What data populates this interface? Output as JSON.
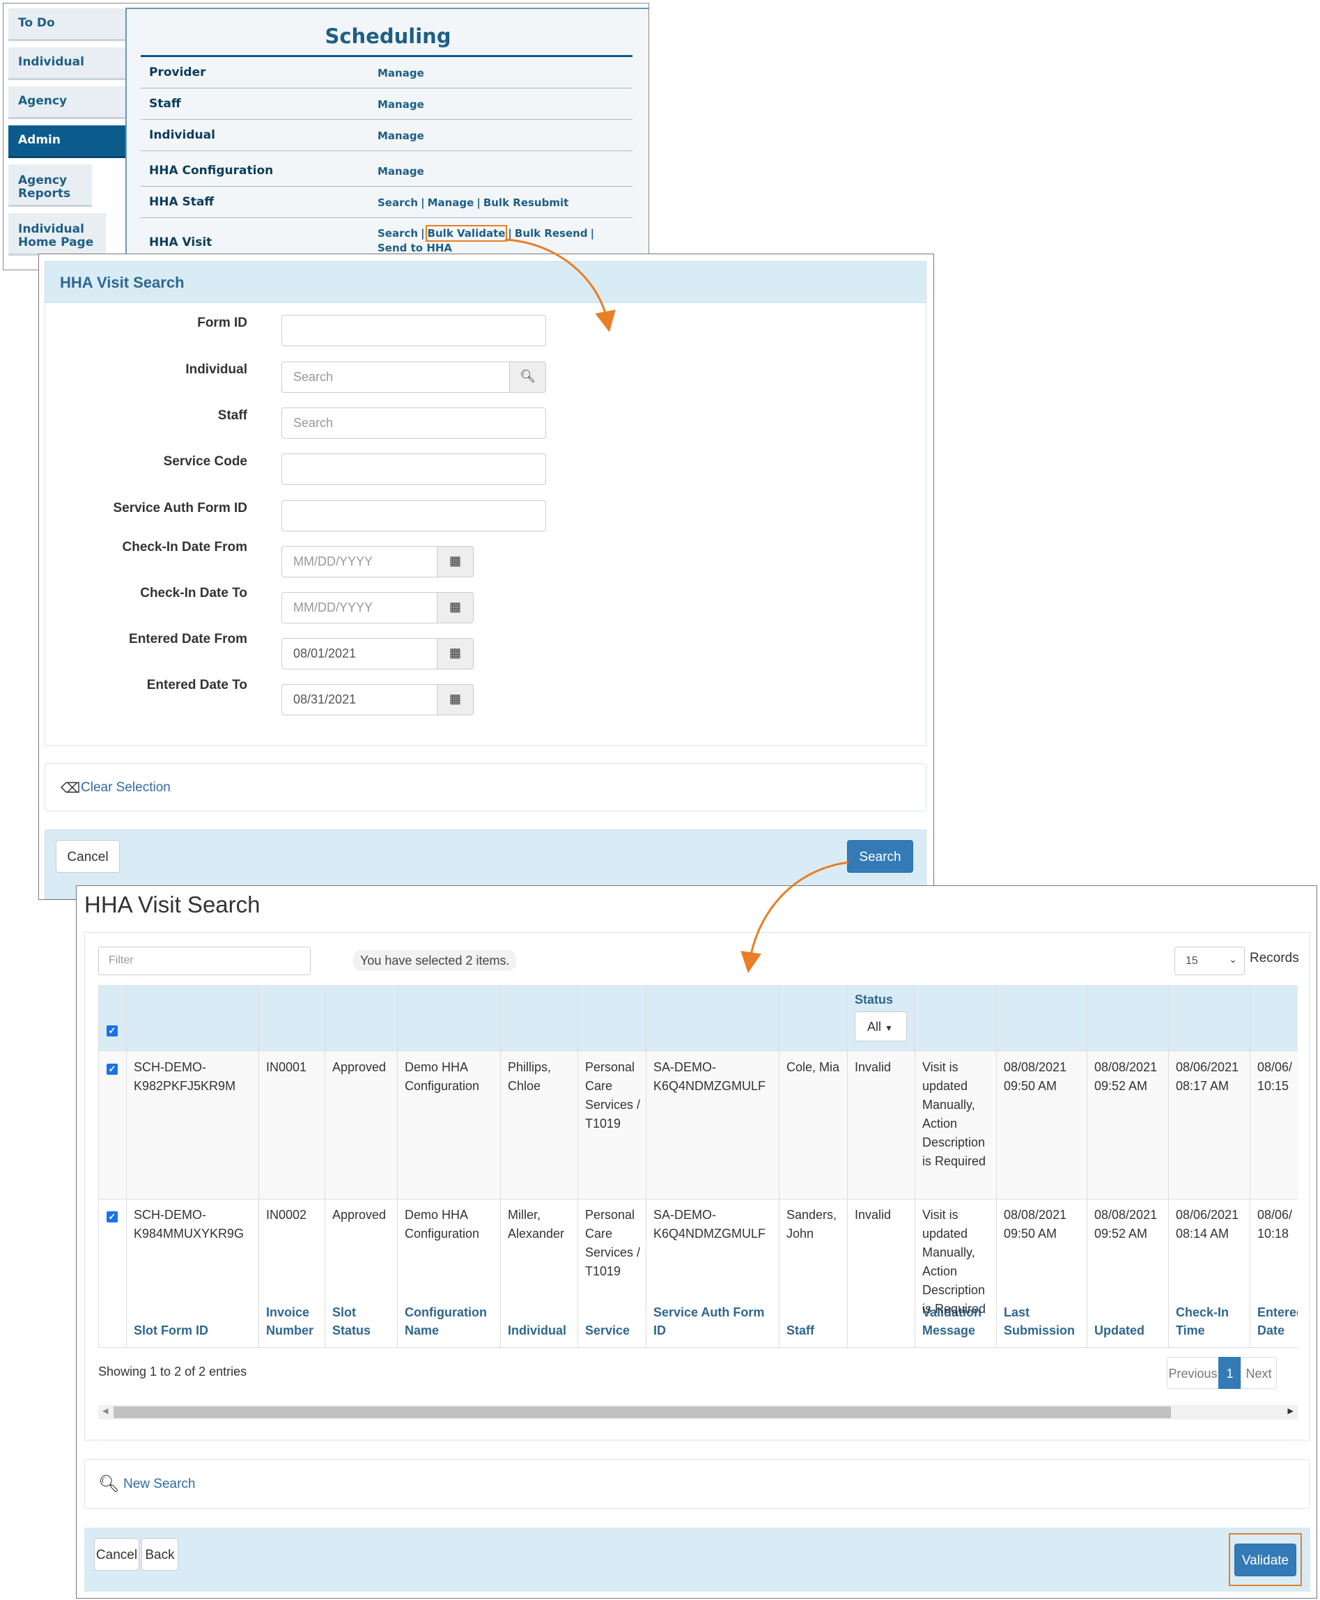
{
  "scheduling": {
    "sidebar": [
      "To Do",
      "Individual",
      "Agency",
      "Admin",
      "Agency Reports",
      "Individual Home Page"
    ],
    "sidebar_active": "Admin",
    "title": "Scheduling",
    "rows": [
      {
        "label": "Provider",
        "links": [
          "Manage"
        ]
      },
      {
        "label": "Staff",
        "links": [
          "Manage"
        ]
      },
      {
        "label": "Individual",
        "links": [
          "Manage"
        ]
      },
      {
        "label": "HHA Configuration",
        "links": [
          "Manage"
        ]
      },
      {
        "label": "HHA Staff",
        "links": [
          "Search",
          "Manage",
          "Bulk Resubmit"
        ]
      },
      {
        "label": "HHA Visit",
        "links": [
          "Search",
          "Bulk Validate",
          "Bulk Resend",
          "Send to HHA"
        ]
      }
    ],
    "highlighted_link": "Bulk Validate"
  },
  "search_form": {
    "title": "HHA Visit Search",
    "fields": [
      {
        "label": "Form ID",
        "value": "",
        "placeholder": ""
      },
      {
        "label": "Individual",
        "value": "",
        "placeholder": "Search",
        "addon_icon": "search-icon"
      },
      {
        "label": "Staff",
        "value": "",
        "placeholder": "Search"
      },
      {
        "label": "Service Code",
        "value": "",
        "placeholder": ""
      },
      {
        "label": "Service Auth Form ID",
        "value": "",
        "placeholder": ""
      },
      {
        "label": "Check-In Date From",
        "value": "",
        "placeholder": "MM/DD/YYYY",
        "addon_icon": "calendar-icon"
      },
      {
        "label": "Check-In Date To",
        "value": "",
        "placeholder": "MM/DD/YYYY",
        "addon_icon": "calendar-icon"
      },
      {
        "label": "Entered Date From",
        "value": "08/01/2021",
        "placeholder": "",
        "addon_icon": "calendar-icon"
      },
      {
        "label": "Entered Date To",
        "value": "08/31/2021",
        "placeholder": "",
        "addon_icon": "calendar-icon"
      }
    ],
    "clear_label": "Clear Selection",
    "cancel_label": "Cancel",
    "search_label": "Search"
  },
  "results": {
    "title": "HHA Visit Search",
    "filter_placeholder": "Filter",
    "selected_text": "You have selected 2 items.",
    "records_value": "15",
    "records_label": "Records",
    "columns": [
      "Slot Form ID",
      "Invoice Number",
      "Slot Status",
      "Configuration Name",
      "Individual",
      "Service",
      "Service Auth Form ID",
      "Staff",
      "Status",
      "Validation Message",
      "Last Submission",
      "Updated",
      "Check-In Time",
      "Entered Date"
    ],
    "status_filter": "All",
    "rows": [
      {
        "checked": true,
        "slot_form_id": "SCH-DEMO-K982PKFJ5KR9M",
        "invoice": "IN0001",
        "slot_status": "Approved",
        "config": "Demo HHA Configuration",
        "individual": "Phillips, Chloe",
        "service": "Personal Care Services / T1019",
        "service_auth": "SA-DEMO-K6Q4NDMZGMULF",
        "staff": "Cole, Mia",
        "status": "Invalid",
        "validation": "Visit is updated Manually, Action Description is Required",
        "last_submission": "08/08/2021 09:50 AM",
        "updated": "08/08/2021 09:52 AM",
        "checkin": "08/06/2021 08:17 AM",
        "entered": "08/06/ 10:15"
      },
      {
        "checked": true,
        "slot_form_id": "SCH-DEMO-K984MMUXYKR9G",
        "invoice": "IN0002",
        "slot_status": "Approved",
        "config": "Demo HHA Configuration",
        "individual": "Miller, Alexander",
        "service": "Personal Care Services / T1019",
        "service_auth": "SA-DEMO-K6Q4NDMZGMULF",
        "staff": "Sanders, John",
        "status": "Invalid",
        "validation": "Visit is updated Manually, Action Description is Required",
        "last_submission": "08/08/2021 09:50 AM",
        "updated": "08/08/2021 09:52 AM",
        "checkin": "08/06/2021 08:14 AM",
        "entered": "08/06/ 10:18"
      }
    ],
    "showing": "Showing 1 to 2 of 2 entries",
    "pagination": {
      "previous": "Previous",
      "page": "1",
      "next": "Next"
    },
    "new_search_label": "New Search",
    "cancel_label": "Cancel",
    "back_label": "Back",
    "validate_label": "Validate"
  },
  "colors": {
    "brand": "#0b5c8d",
    "primary_button": "#337ab7",
    "panel_header": "#d9ecf5",
    "highlight": "#e87e25"
  }
}
